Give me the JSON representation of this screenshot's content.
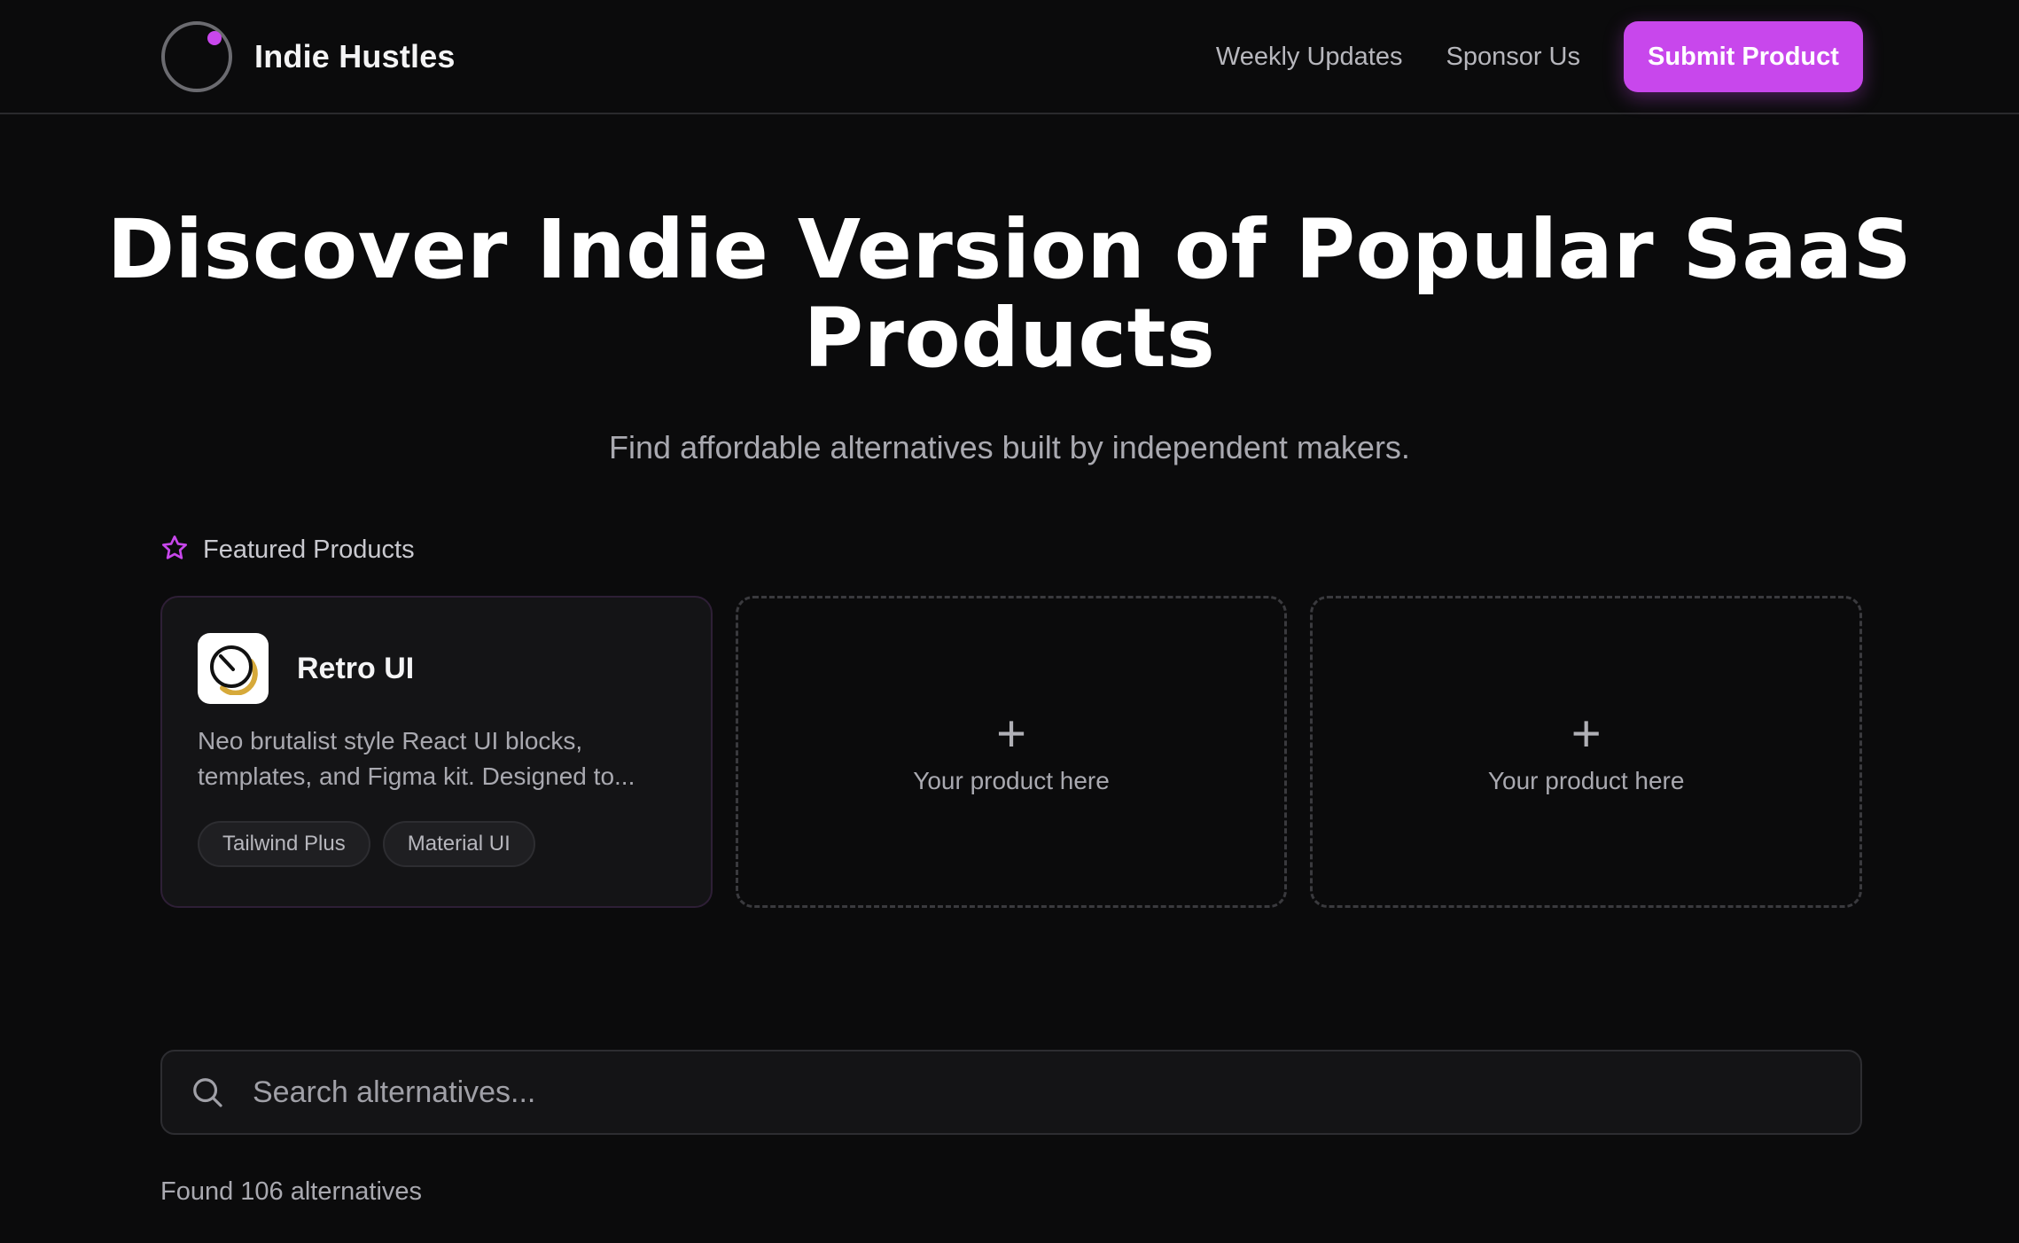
{
  "header": {
    "brand_name": "Indie Hustles",
    "nav": {
      "weekly_updates": "Weekly Updates",
      "sponsor_us": "Sponsor Us"
    },
    "submit_label": "Submit Product"
  },
  "hero": {
    "title": "Discover Indie Version of Popular SaaS Products",
    "subtitle": "Find affordable alternatives built by independent makers."
  },
  "featured": {
    "label": "Featured Products",
    "icon": "star-icon",
    "product": {
      "name": "Retro UI",
      "description": "Neo brutalist style React UI blocks, templates, and Figma kit. Designed to...",
      "tags": [
        "Tailwind Plus",
        "Material UI"
      ]
    },
    "placeholders": [
      {
        "plus": "+",
        "text": "Your product here"
      },
      {
        "plus": "+",
        "text": "Your product here"
      }
    ]
  },
  "search": {
    "placeholder": "Search alternatives...",
    "value": "",
    "icon": "search-icon"
  },
  "results": {
    "found_text": "Found 106 alternatives"
  },
  "colors": {
    "background": "#0b0b0c",
    "accent": "#c847ec",
    "card": "#141416"
  }
}
